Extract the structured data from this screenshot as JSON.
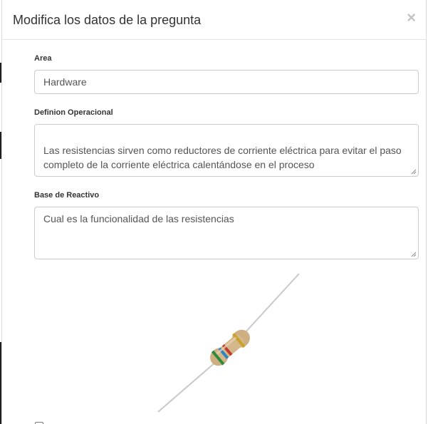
{
  "modal": {
    "title": "Modifica los datos de la pregunta",
    "close_glyph": "×"
  },
  "form": {
    "area": {
      "label": "Area",
      "value": "Hardware"
    },
    "definicion": {
      "label": "Definion Operacional",
      "value_line1": "Las resistencias sirven como reductores de corriente eléctrica para evitar el paso",
      "value_line2": "completo de la corriente eléctrica calentándose en el proceso"
    },
    "base": {
      "label": "Base de Reactivo",
      "value": "Cual es la funcionalidad de las resistencias"
    },
    "image": {
      "subject": "resistor-image",
      "band_colors": [
        "#c0392b",
        "#2e86c1",
        "#2e8b3e",
        "#d4a017"
      ]
    },
    "checkbox": {
      "checked": false
    }
  },
  "colors": {
    "title": "#333333",
    "border": "#cccccc",
    "close": "#c4c4c4"
  }
}
